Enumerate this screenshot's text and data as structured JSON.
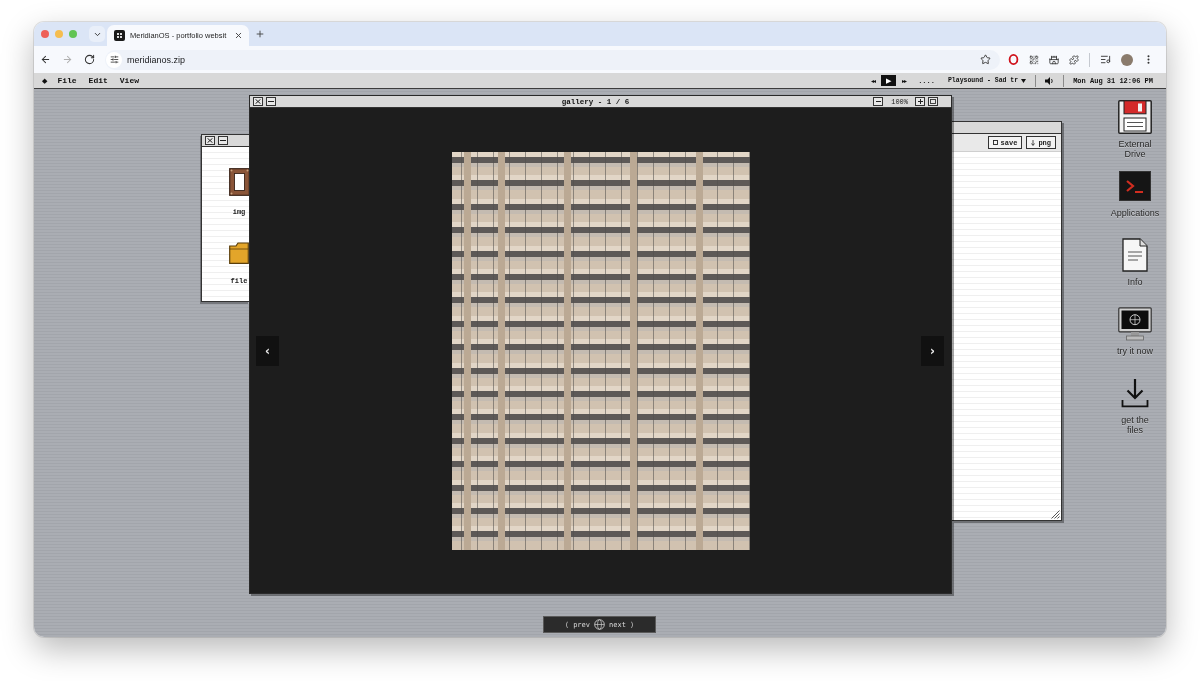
{
  "browser": {
    "tabs": [
      {
        "title": "MeridianOS - portfolio websit",
        "selected": true
      }
    ],
    "address": "meridianos.zip"
  },
  "menubar": {
    "logo": "◆",
    "menus": [
      "File",
      "Edit",
      "View"
    ],
    "player": {
      "rewind": "◂◂",
      "play": "▶",
      "forward": "▸▸",
      "dots": "....",
      "track": "Playsound - Sad tr"
    },
    "clock": "Mon Aug 31 12:06 PM"
  },
  "files_window": {
    "items": [
      {
        "kind": "image",
        "label": "img"
      },
      {
        "kind": "folder",
        "label": "file"
      }
    ]
  },
  "editor_window": {
    "buttons": [
      {
        "kind": "save",
        "label": "save"
      },
      {
        "kind": "download",
        "label": "png"
      }
    ]
  },
  "gallery": {
    "title": "gallery - 1 / 6",
    "zoom": "100%",
    "prev_arrow": "‹",
    "next_arrow": "›"
  },
  "desktop_icons": [
    {
      "kind": "drive",
      "label": "External Drive"
    },
    {
      "kind": "terminal",
      "label": "Applications"
    },
    {
      "kind": "document",
      "label": "Info"
    },
    {
      "kind": "monitor",
      "label": "try it now"
    },
    {
      "kind": "download",
      "label": "get the files"
    }
  ],
  "gallery_nav": {
    "prev": "⟨ prev",
    "next": "next ⟩"
  }
}
